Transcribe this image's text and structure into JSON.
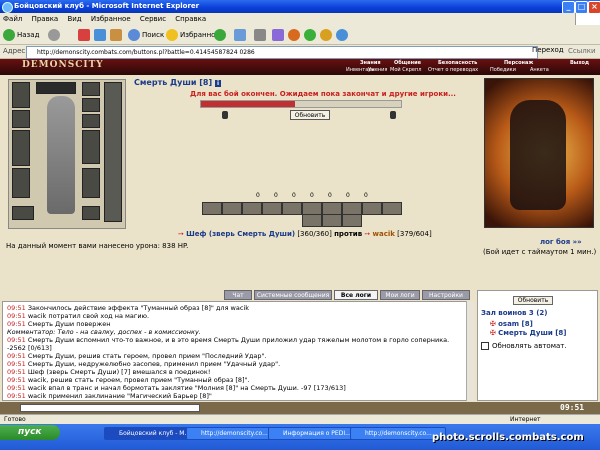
{
  "window": {
    "title": "Бойцовский клуб - Microsoft Internet Explorer"
  },
  "menu": [
    "Файл",
    "Правка",
    "Вид",
    "Избранное",
    "Сервис",
    "Справка"
  ],
  "toolbar": {
    "back": "Назад",
    "search": "Поиск",
    "favorites": "Избранное"
  },
  "address": {
    "label": "Адрес:",
    "url": "http://demonscity.combats.com/buttons.pl?battle=0.41454587824 0286",
    "go": "Переход",
    "links": "Ссылки"
  },
  "game": {
    "logo": "DEMONSCITY",
    "nav_top": [
      "Знания",
      "Общение",
      "Безопасность",
      "Персонаж",
      "Выход"
    ],
    "nav_bot": [
      "Инвентарь",
      "Умения",
      "Мой Скрепл",
      "Отчет о переводах",
      "Победики",
      "Анкета"
    ],
    "player": "Смерть Души [8]",
    "level_badge": "i",
    "battle_message": "Для вас бой окончен. Ожидаем пока закончат и другие игроки...",
    "refresh_btn": "Обновить",
    "counters": [
      "0",
      "0",
      "0",
      "0",
      "0",
      "0",
      "0"
    ],
    "battle_left": "Шеф (зверь Смерть Души)",
    "battle_left_hp": "[360/360]",
    "battle_vs": "против",
    "battle_right": "wacik",
    "battle_right_hp": "[379/604]",
    "damage": "На данный момент вами нанесено урона: 838 HP.",
    "log_link": "лог боя »»",
    "timeout": "(Бой идет с таймаутом 1 мин.)",
    "progress_fraction": 0.47
  },
  "tabs": [
    "Чат",
    "Системные сообщения",
    "Все логи",
    "Мои логи",
    "Настройки"
  ],
  "active_tab": "Все логи",
  "log": [
    {
      "time": "09:51",
      "text": "Закончилось действие эффекта \"Туманный образ [8]\" для wacik"
    },
    {
      "time": "09:51",
      "text": "wacik потратил свой ход на магию."
    },
    {
      "time": "09:51",
      "text": "Смерть Души повержен"
    },
    {
      "time": "",
      "text": "Комментатор: Тело - на свалку, доспех - в комиссионку."
    },
    {
      "time": "09:51",
      "text": "Смерть Души вспомнил что-то важное, и в это время Смерть Души приложил удар тяжелым молотом в горло соперника. -2562 [0/613]"
    },
    {
      "time": "09:51",
      "text": "Смерть Души, решив стать героем, провел прием \"Последний Удар\"."
    },
    {
      "time": "09:51",
      "text": "Смерть Души, недружелюбно засопев, применил прием \"Удачный удар\"."
    },
    {
      "time": "09:51",
      "text": "Шеф (зверь Смерть Души) [7] вмешался в поединок!"
    },
    {
      "time": "09:51",
      "text": "wacik, решив стать героем, провел прием \"Туманный образ [8]\"."
    },
    {
      "time": "09:51",
      "text": "wacik впал в транс и начал бормотать заклятие \"Молния [8]\" на Смерть Души. -97 [173/613]"
    },
    {
      "time": "09:51",
      "text": "wacik применил заклинание \"Магический Барьер [8]\""
    }
  ],
  "right": {
    "refresh": "Обновить",
    "hall_title": "Зал воинов 3 (2)",
    "members": [
      "osam [8]",
      "Смерть Души [8]"
    ],
    "auto_refresh": "Обновлять автомат."
  },
  "clock": "09:51",
  "status": {
    "left": "Готово",
    "right": "Интернет"
  },
  "taskbar": {
    "start": "пуск",
    "tasks": [
      "Бойцовский клуб - М...",
      "http://demonscity.co...",
      "Информация о PEDI...",
      "http://demonscity.co..."
    ]
  },
  "watermark": "photo.scrolls.combats.com",
  "colors": {
    "accent": "#0a3fd8",
    "game_header": "#6a1010",
    "time_red": "#c82020",
    "name_blue": "#1a3a8a"
  }
}
